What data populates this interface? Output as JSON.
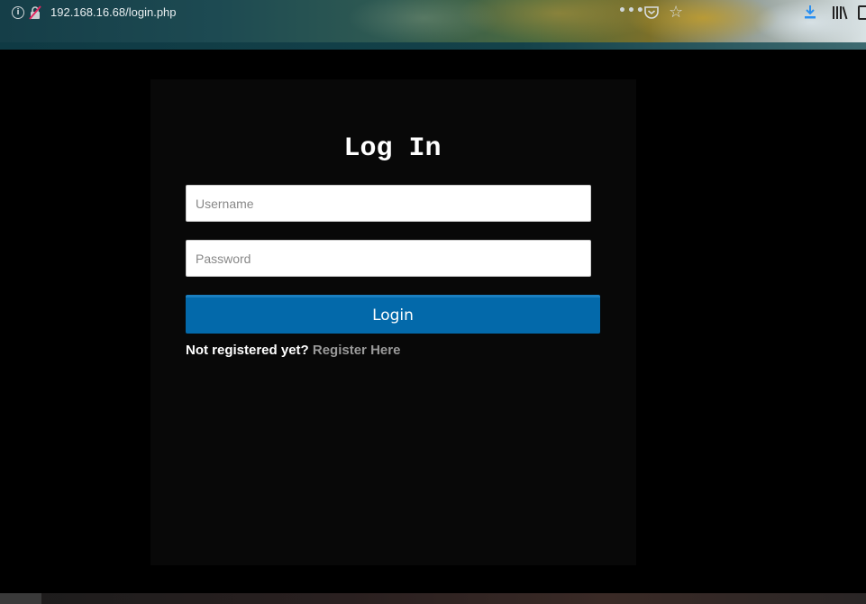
{
  "browser": {
    "url": "192.168.16.68/login.php",
    "info_glyph": "i",
    "more_glyph": "•••",
    "star_glyph": "☆"
  },
  "login": {
    "title": "Log In",
    "username_placeholder": "Username",
    "password_placeholder": "Password",
    "login_button": "Login",
    "register_prompt": "Not registered yet?",
    "register_link": "Register Here"
  },
  "colors": {
    "button": "#0369aa",
    "panel": "#080808",
    "link": "#9a9a9a"
  }
}
